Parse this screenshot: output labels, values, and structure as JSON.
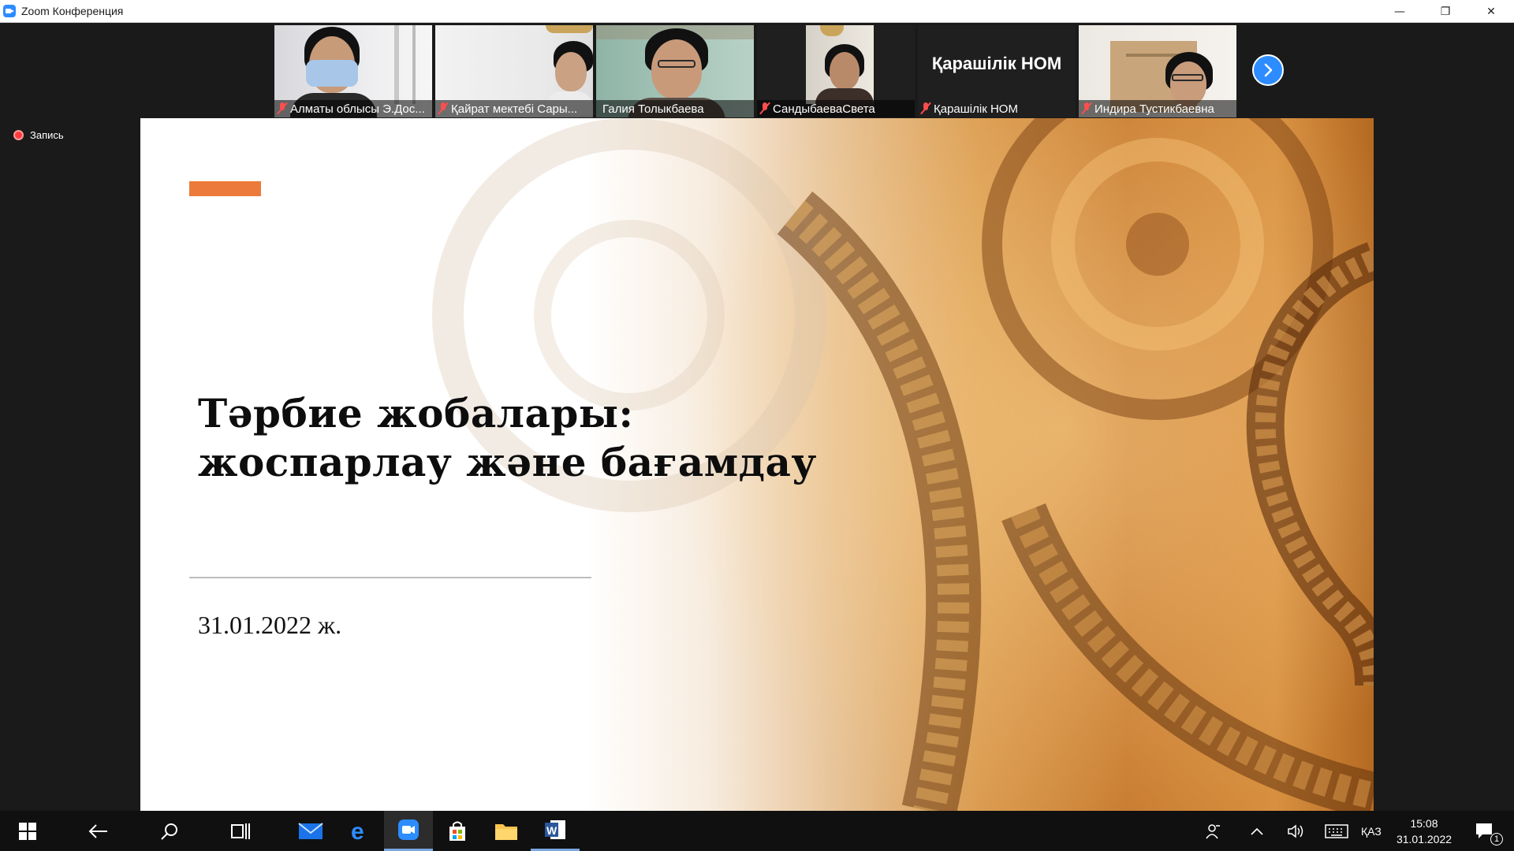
{
  "window": {
    "title": "Zoom Конференция",
    "icon": "zoom-icon",
    "controls": {
      "minimize": "—",
      "restore": "❐",
      "close": "✕"
    }
  },
  "participants": [
    {
      "name": "Алматы облысы Э.Дос...",
      "muted": true,
      "active": true
    },
    {
      "name": "Қайрат мектебі Сары...",
      "muted": true,
      "active": false
    },
    {
      "name": "Галия Толыкбаева",
      "muted": false,
      "active": false
    },
    {
      "name": "СандыбаеваСвета",
      "muted": true,
      "active": false
    },
    {
      "name": "Қарашілік НОМ",
      "muted": true,
      "active": false,
      "display_name": "Қарашілік НОМ"
    },
    {
      "name": "Индира Тустикбаевна",
      "muted": true,
      "active": false
    }
  ],
  "strip": {
    "next_icon": "chevron-right-icon"
  },
  "recording": {
    "label": "Запись"
  },
  "slide": {
    "title_line1": "Тәрбие жобалары:",
    "title_line2": "жоспарлау және бағамдау",
    "date": "31.01.2022 ж.",
    "accent_color": "#ec7a3a"
  },
  "taskbar": {
    "items": [
      "windows-start-icon",
      "back-icon",
      "search-icon",
      "task-view-icon",
      "mail-icon",
      "edge-icon",
      "zoom-icon",
      "store-icon",
      "file-explorer-icon",
      "word-icon"
    ],
    "tray": {
      "language": "ҚАЗ",
      "time": "15:08",
      "date": "31.01.2022",
      "notifications": "1"
    }
  }
}
